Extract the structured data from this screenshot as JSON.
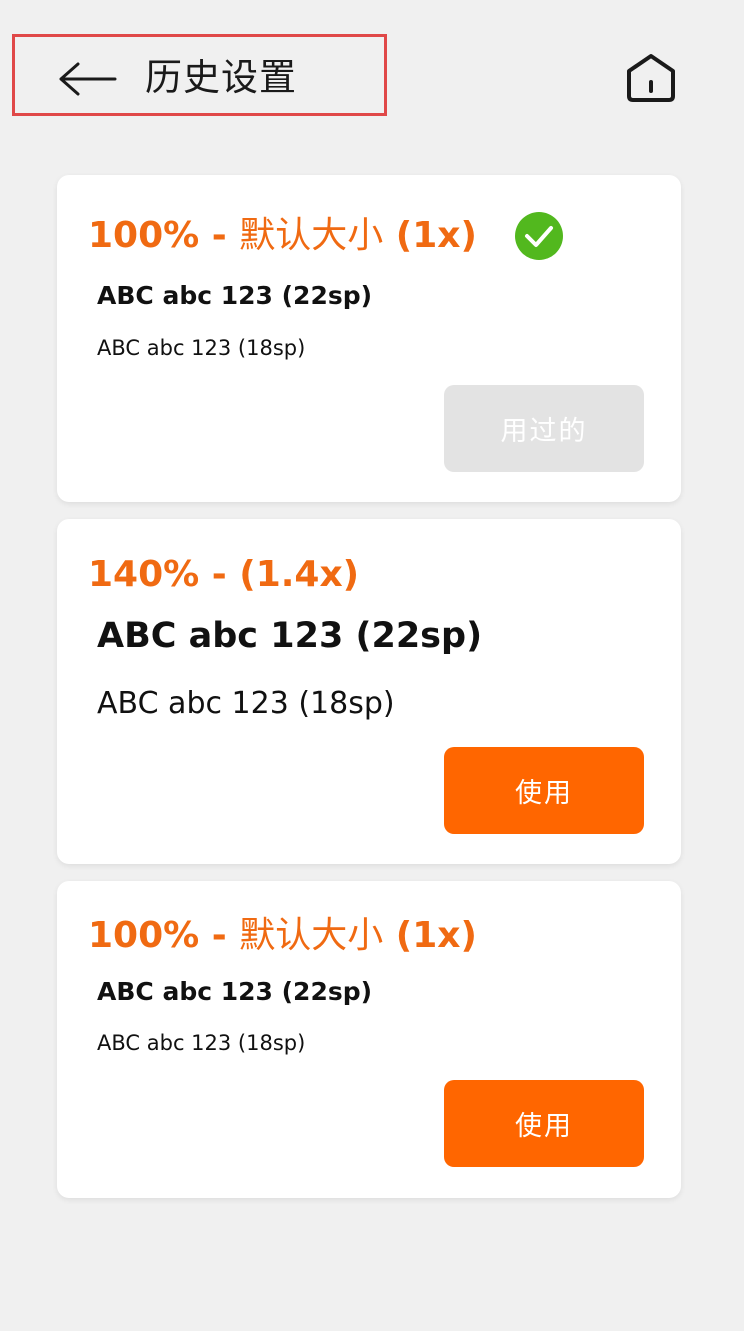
{
  "header": {
    "title": "历史设置",
    "back_icon": "arrow-left-icon",
    "home_icon": "home-icon"
  },
  "colors": {
    "accent": "#ff6600",
    "title_orange": "#f06a12",
    "check_green": "#52b81e",
    "disabled_button": "#e3e3e3",
    "highlight_border": "#e04848"
  },
  "cards": [
    {
      "scale_label": "100% - ",
      "scale_name": "默认大小",
      "scale_suffix": " (1x)",
      "large_sample": "ABC abc 123 (22sp)",
      "small_sample": "ABC abc 123 (18sp)",
      "button_label": "用过的",
      "selected": true
    },
    {
      "scale_label": "140% - ",
      "scale_name": "",
      "scale_suffix": "(1.4x)",
      "large_sample": "ABC abc 123 (22sp)",
      "small_sample": "ABC abc 123 (18sp)",
      "button_label": "使用",
      "selected": false
    },
    {
      "scale_label": "100% - ",
      "scale_name": "默认大小",
      "scale_suffix": " (1x)",
      "large_sample": "ABC abc 123 (22sp)",
      "small_sample": "ABC abc 123 (18sp)",
      "button_label": "使用",
      "selected": false
    }
  ]
}
